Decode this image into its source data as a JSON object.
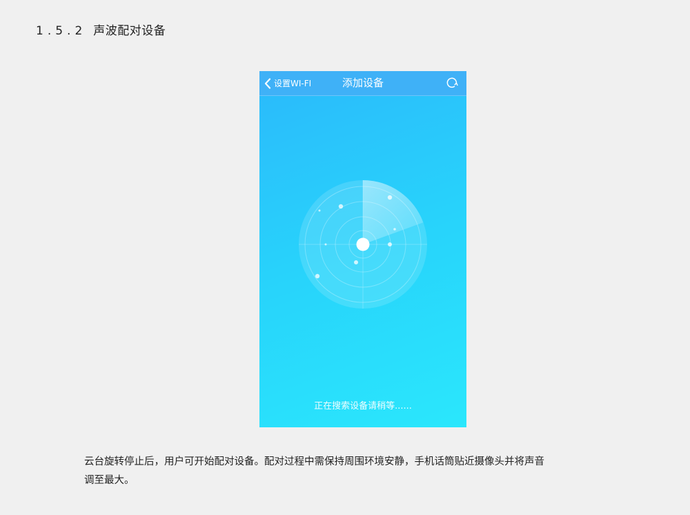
{
  "section": {
    "number": "1.5.2",
    "title": "声波配对设备"
  },
  "phone": {
    "navbar": {
      "back_label": "设置WI-FI",
      "title": "添加设备",
      "back_icon": "chevron-left-icon",
      "refresh_icon": "refresh-icon"
    },
    "status_text": "正在搜索设备请稍等......"
  },
  "description": {
    "line1": "云台旋转停止后，用户可开始配对设备。配对过程中需保持周围环境安静，手机话筒贴近摄像头并将声音",
    "line2": "调至最大。"
  },
  "colors": {
    "navbar": "#3fb1f7",
    "gradient_top": "#2bb9fb",
    "gradient_bottom": "#2ae7fc",
    "page_bg": "#f0f0f0"
  }
}
